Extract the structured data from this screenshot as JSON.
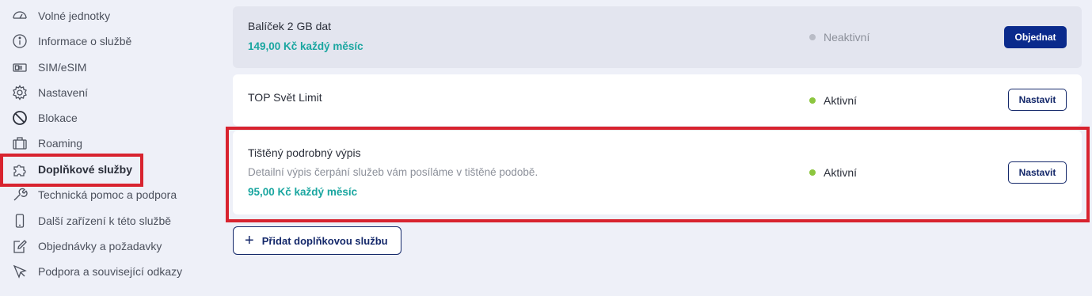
{
  "sidebar": {
    "items": [
      {
        "label": "Volné jednotky",
        "icon": "gauge-icon"
      },
      {
        "label": "Informace o službě",
        "icon": "info-icon"
      },
      {
        "label": "SIM/eSIM",
        "icon": "sim-card-icon"
      },
      {
        "label": "Nastavení",
        "icon": "gear-icon"
      },
      {
        "label": "Blokace",
        "icon": "block-icon"
      },
      {
        "label": "Roaming",
        "icon": "suitcase-icon"
      },
      {
        "label": "Doplňkové služby",
        "icon": "puzzle-icon",
        "active": true
      },
      {
        "label": "Technická pomoc a podpora",
        "icon": "wrench-icon"
      },
      {
        "label": "Další zařízení k této službě",
        "icon": "phone-icon"
      },
      {
        "label": "Objednávky a požadavky",
        "icon": "edit-icon"
      },
      {
        "label": "Podpora a související odkazy",
        "icon": "cursor-icon"
      }
    ]
  },
  "services": [
    {
      "title": "Balíček 2 GB dat",
      "description": "",
      "price": "149,00 Kč každý měsíc",
      "status": "Neaktivní",
      "button": "Objednat"
    },
    {
      "title": "TOP Svět Limit",
      "description": "",
      "price": "",
      "status": "Aktivní",
      "button": "Nastavit"
    },
    {
      "title": "Tištěný podrobný výpis",
      "description": "Detailní výpis čerpání služeb vám posíláme v tištěné podobě.",
      "price": "95,00 Kč každý měsíc",
      "status": "Aktivní",
      "button": "Nastavit"
    }
  ],
  "add_service": {
    "icon": "plus-icon",
    "label": "Přidat doplňkovou službu"
  },
  "colors": {
    "accent": "#0a2a8c",
    "price": "#1aa6a0",
    "status_active": "#8cc63f",
    "status_inactive": "#b9bcc6",
    "highlight": "#d8232f"
  }
}
